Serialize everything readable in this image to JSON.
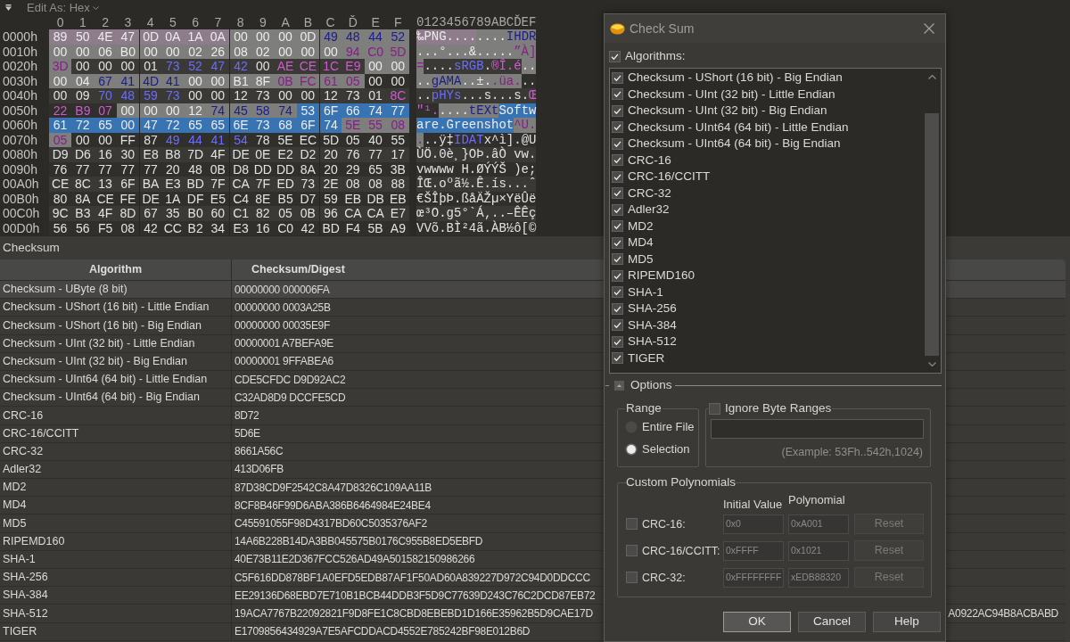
{
  "hex_view": {
    "toolbar": {
      "label": "Edit As: Hex"
    },
    "columns": [
      "0",
      "1",
      "2",
      "3",
      "4",
      "5",
      "6",
      "7",
      "8",
      "9",
      "A",
      "B",
      "C",
      "Ď",
      "E",
      "F"
    ],
    "ascii_header": "0123456789ABCĎEF",
    "rows": [
      {
        "offset": "0000h",
        "segments": [
          {
            "kind": "value",
            "color": "#8e7c8d",
            "selected": false,
            "bytes": "89 50 4E 47 0D 0A 1A 0A"
          },
          {
            "kind": "value",
            "color": "#7e7e7c",
            "selected": false,
            "bytes": "00 00 00 0D"
          },
          {
            "kind": "type",
            "color": "#7e7e7c",
            "selected": false,
            "bytes": "49 48 44 52"
          }
        ],
        "ascii": "‰PNG........IHDR"
      },
      {
        "offset": "0010h",
        "segments": [
          {
            "kind": "value",
            "color": "#7e7e7c",
            "selected": false,
            "bytes": "00 00 06 B0 00 00 02 26 08 02 00 00 00"
          },
          {
            "kind": "crc",
            "color": "#7e7e7c",
            "selected": false,
            "bytes": "94 C0 5D"
          }
        ],
        "ascii": "...°...&.....”À]"
      },
      {
        "offset": "0020h",
        "segments": [
          {
            "kind": "crc",
            "color": "#7e7e7c",
            "selected": false,
            "bytes": "3D"
          },
          {
            "kind": "value",
            "selected": false,
            "bytes": "00 00 00 01"
          },
          {
            "kind": "type",
            "selected": false,
            "bytes": "73 52 47 42"
          },
          {
            "kind": "value",
            "selected": false,
            "bytes": "00"
          },
          {
            "kind": "crc",
            "selected": false,
            "bytes": "AE CE 1C E9"
          },
          {
            "kind": "value",
            "color": "#7e7e7c",
            "selected": false,
            "bytes": "00 00"
          }
        ],
        "ascii": "=....sRGB.®Î.é.."
      },
      {
        "offset": "0030h",
        "segments": [
          {
            "kind": "value",
            "color": "#7e7e7c",
            "selected": false,
            "bytes": "00 04"
          },
          {
            "kind": "type",
            "color": "#7e7e7c",
            "selected": false,
            "bytes": "67 41 4D 41"
          },
          {
            "kind": "value",
            "color": "#7e7e7c",
            "selected": false,
            "bytes": "00 00 B1 8F"
          },
          {
            "kind": "crc",
            "color": "#7e7e7c",
            "selected": false,
            "bytes": "0B FC 61 05"
          },
          {
            "kind": "value",
            "selected": false,
            "bytes": "00 00"
          }
        ],
        "ascii": "..gAMA..±..üa..."
      },
      {
        "offset": "0040h",
        "segments": [
          {
            "kind": "value",
            "selected": false,
            "bytes": "00 09"
          },
          {
            "kind": "type",
            "selected": false,
            "bytes": "70 48 59 73"
          },
          {
            "kind": "value",
            "selected": false,
            "bytes": "00 00 12 73 00 00 12 73 01"
          },
          {
            "kind": "crc",
            "selected": false,
            "bytes": "8C"
          }
        ],
        "ascii": "..pHYs...s...s.Œ"
      },
      {
        "offset": "0050h",
        "segments": [
          {
            "kind": "crc",
            "selected": false,
            "bytes": "22 B9 07"
          },
          {
            "kind": "value",
            "color": "#7e7e7c",
            "selected": false,
            "bytes": "00 00 00 12"
          },
          {
            "kind": "type",
            "color": "#7e7e7c",
            "selected": false,
            "bytes": "74 45 58 74"
          },
          {
            "kind": "value",
            "selected": true,
            "bytes": "53 6F 66 74 77"
          }
        ],
        "ascii": "\"¹.....tEXtSoftw"
      },
      {
        "offset": "0060h",
        "segments": [
          {
            "kind": "value",
            "selected": true,
            "bytes": "61 72 65 00 47 72 65 65 6E 73 68 6F 74"
          },
          {
            "kind": "crc",
            "color": "#7e7e7c",
            "selected": false,
            "bytes": "5E 55 08"
          }
        ],
        "ascii": "are.Greenshot^U."
      },
      {
        "offset": "0070h",
        "segments": [
          {
            "kind": "crc",
            "color": "#7e7e7c",
            "selected": false,
            "bytes": "05"
          },
          {
            "kind": "value",
            "selected": false,
            "bytes": "00 00 FF 87"
          },
          {
            "kind": "type",
            "selected": false,
            "bytes": "49 44 41 54"
          },
          {
            "kind": "value",
            "selected": false,
            "bytes": "78 5E EC 5D 05 40 55"
          }
        ],
        "ascii": "...ÿ‡IDATx^ì].@U"
      },
      {
        "offset": "0080h",
        "segments": [
          {
            "kind": "value",
            "selected": false,
            "bytes": "D9 D6 16 30 E8 B8 7D 4F DE 0E E2 D2 20 76 77 17"
          }
        ],
        "ascii": "ÙÖ.0è¸}OÞ.âÒ vw."
      },
      {
        "offset": "0090h",
        "segments": [
          {
            "kind": "value",
            "selected": false,
            "bytes": "76 77 77 77 77 20 48 0B D8 DD DD 8A 20 29 65 3B"
          }
        ],
        "ascii": "vwwww H.ØÝÝŠ )e;"
      },
      {
        "offset": "00A0h",
        "segments": [
          {
            "kind": "value",
            "selected": false,
            "bytes": "CE 8C 13 6F BA E3 BD 7F CA 7F ED 73 2E 08 08 88"
          }
        ],
        "ascii": "ÎŒ.oºã½.Ê.ís...ˆ"
      },
      {
        "offset": "00B0h",
        "segments": [
          {
            "kind": "value",
            "selected": false,
            "bytes": "80 8A CE FE DE 1A DF E5 C4 8E B5 D7 59 EB DB EB"
          }
        ],
        "ascii": "€ŠÎþÞ.ßåÄŽµ×YëÛë"
      },
      {
        "offset": "00C0h",
        "segments": [
          {
            "kind": "value",
            "selected": false,
            "bytes": "9C B3 4F 8D 67 35 B0 60 C1 82 05 0B 96 CA CA E7"
          }
        ],
        "ascii": "œ³O.g5°`Á‚..–ÊÊç"
      },
      {
        "offset": "00D0h",
        "segments": [
          {
            "kind": "value",
            "selected": false,
            "bytes": "56 56 F5 08 42 CC B2 34 E3 16 C0 42 BD F4 5B A9"
          }
        ],
        "ascii": "VVõ.BÌ²4ã.ÀB½ô[©"
      }
    ]
  },
  "checksum_panel": {
    "title": "Checksum",
    "columns": [
      "Algorithm",
      "Checksum/Digest"
    ],
    "rows": [
      {
        "algorithm": "Checksum - UByte (8 bit)",
        "digest": "00000000 000006FA",
        "selected": true
      },
      {
        "algorithm": "Checksum - UShort (16 bit) - Little Endian",
        "digest": "00000000 0003A25B",
        "selected": false
      },
      {
        "algorithm": "Checksum - UShort (16 bit) - Big Endian",
        "digest": "00000000 00035E9F",
        "selected": false
      },
      {
        "algorithm": "Checksum - UInt (32 bit) - Little Endian",
        "digest": "00000001 A7BEFA9E",
        "selected": false
      },
      {
        "algorithm": "Checksum - UInt (32 bit) - Big Endian",
        "digest": "00000001 9FFABEA6",
        "selected": false
      },
      {
        "algorithm": "Checksum - UInt64 (64 bit) - Little Endian",
        "digest": "CDE5CFDC D9D92AC2",
        "selected": false
      },
      {
        "algorithm": "Checksum - UInt64 (64 bit) - Big Endian",
        "digest": "C32AD8D9 DCCFE5CD",
        "selected": false
      },
      {
        "algorithm": "CRC-16",
        "digest": "8D72",
        "selected": false
      },
      {
        "algorithm": "CRC-16/CCITT",
        "digest": "5D6E",
        "selected": false
      },
      {
        "algorithm": "CRC-32",
        "digest": "8661A56C",
        "selected": false
      },
      {
        "algorithm": "Adler32",
        "digest": "413D06FB",
        "selected": false
      },
      {
        "algorithm": "MD2",
        "digest": "87D38CD9F2542C8A47D8326C109AA11B",
        "selected": false
      },
      {
        "algorithm": "MD4",
        "digest": "8CF8B46F99D6ABA386B6464984E24BE4",
        "selected": false
      },
      {
        "algorithm": "MD5",
        "digest": "C45591055F98D4317BD60C5035376AF2",
        "selected": false
      },
      {
        "algorithm": "RIPEMD160",
        "digest": "14A6B228B14DA3BB045575B0176C955B8ED5EBFD",
        "selected": false
      },
      {
        "algorithm": "SHA-1",
        "digest": "40E73B11E2D367FCC526AD49A501582150986266",
        "selected": false
      },
      {
        "algorithm": "SHA-256",
        "digest": "C5F616DD878BF1A0EFD5EDB87AF1F50AD60A839227D972C94D0DDCCC",
        "selected": false
      },
      {
        "algorithm": "SHA-384",
        "digest": "EE29136D68EBD7E710B1BCB44DDB3F5D9C77639D243C76C2DCD87EB72",
        "selected": false
      },
      {
        "algorithm": "SHA-512",
        "digest": "19ACA7767B22092821F9D8FE1C8CBD8EBEBD1D166E35962B5D9CAE17D",
        "digest_tail": "A0922AC94B8ACBABD",
        "selected": false
      },
      {
        "algorithm": "TIGER",
        "digest": "E1709856434929A7E5AFCDDACD4552E785242BF98E012B6D",
        "selected": false
      }
    ]
  },
  "dialog": {
    "title": "Check Sum",
    "algorithms": {
      "label": "Algorithms:",
      "checked": true,
      "items": [
        {
          "label": "Checksum - UShort (16 bit) - Big Endian",
          "checked": true
        },
        {
          "label": "Checksum - UInt (32 bit) - Little Endian",
          "checked": true
        },
        {
          "label": "Checksum - UInt (32 bit) - Big Endian",
          "checked": true
        },
        {
          "label": "Checksum - UInt64 (64 bit) - Little Endian",
          "checked": true
        },
        {
          "label": "Checksum - UInt64 (64 bit) - Big Endian",
          "checked": true
        },
        {
          "label": "CRC-16",
          "checked": true
        },
        {
          "label": "CRC-16/CCITT",
          "checked": true
        },
        {
          "label": "CRC-32",
          "checked": true
        },
        {
          "label": "Adler32",
          "checked": true
        },
        {
          "label": "MD2",
          "checked": true
        },
        {
          "label": "MD4",
          "checked": true
        },
        {
          "label": "MD5",
          "checked": true
        },
        {
          "label": "RIPEMD160",
          "checked": true
        },
        {
          "label": "SHA-1",
          "checked": true
        },
        {
          "label": "SHA-256",
          "checked": true
        },
        {
          "label": "SHA-384",
          "checked": true
        },
        {
          "label": "SHA-512",
          "checked": true
        },
        {
          "label": "TIGER",
          "checked": true
        }
      ]
    },
    "options": {
      "label": "Options",
      "expanded": true
    },
    "range": {
      "title": "Range",
      "options": [
        {
          "label": "Entire File",
          "selected": false
        },
        {
          "label": "Selection",
          "selected": true
        }
      ]
    },
    "ignore_ranges": {
      "label": "Ignore Byte Ranges",
      "checked": false,
      "example": "(Example: 53Fh..542h,1024)"
    },
    "custom_polynomials": {
      "title": "Custom Polynomials",
      "columns": [
        "Initial Value",
        "Polynomial"
      ],
      "rows": [
        {
          "label": "CRC-16:",
          "checked": false,
          "disabled": true,
          "initial_value": "0x0",
          "polynomial": "0xA001",
          "button": "Reset"
        },
        {
          "label": "CRC-16/CCITT:",
          "checked": false,
          "disabled": true,
          "initial_value": "0xFFFF",
          "polynomial": "0x1021",
          "button": "Reset"
        },
        {
          "label": "CRC-32:",
          "checked": false,
          "disabled": true,
          "initial_value": "0xFFFFFFFF",
          "polynomial": "xEDB88320",
          "button": "Reset"
        }
      ]
    },
    "buttons": [
      {
        "label": "OK",
        "default": true
      },
      {
        "label": "Cancel",
        "default": false
      },
      {
        "label": "Help",
        "default": false
      }
    ]
  }
}
